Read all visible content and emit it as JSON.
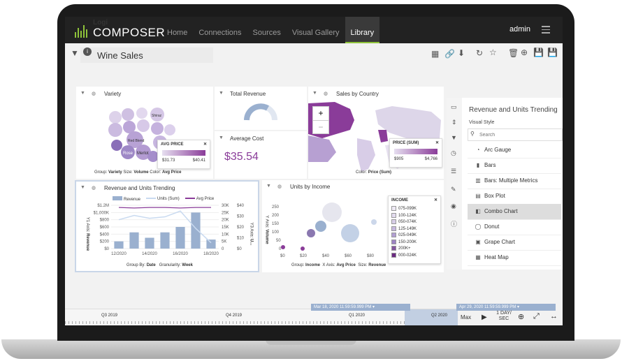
{
  "app": {
    "logo_small": "Logi",
    "logo_big": "COMPOSER",
    "nav": [
      "Home",
      "Connections",
      "Sources",
      "Visual Gallery",
      "Library"
    ],
    "active_nav": "Library",
    "user": "admin"
  },
  "dashboard": {
    "title": "Wine Sales"
  },
  "panels": {
    "variety": {
      "title": "Variety",
      "bubbles": [
        "Shiraz",
        "Red Blend",
        "Rose",
        "Merlot"
      ],
      "legend_title": "AVG PRICE",
      "legend_min": "$31.73",
      "legend_max": "$40.41",
      "footer_group_label": "Group:",
      "footer_group": "Variety",
      "footer_size_label": "Size:",
      "footer_size": "Volume",
      "footer_color_label": "Color:",
      "footer_color": "Avg Price"
    },
    "total_revenue": {
      "title": "Total Revenue"
    },
    "average_cost": {
      "title": "Average Cost",
      "value": "$35.54"
    },
    "sales_by_country": {
      "title": "Sales by Country",
      "legend_title": "PRICE (SUM)",
      "legend_min": "$905",
      "legend_max": "$4,766",
      "footer_color_label": "Color:",
      "footer_color": "Price (Sum)",
      "zoom_plus": "+",
      "zoom_minus": "−"
    },
    "revenue_trending": {
      "title": "Revenue and Units Trending",
      "legend": [
        "Revenue",
        "Units (Sum)",
        "Avg Price"
      ],
      "y1_label_prefix": "Y1 Axis:",
      "y1_label": "Revenue",
      "y2_label_prefix": "Y3 Axis:",
      "y2_label": "U...",
      "footer_group_label": "Group By:",
      "footer_group": "Date",
      "footer_gran_label": "Granularity:",
      "footer_gran": "Week"
    },
    "units_by_income": {
      "title": "Units by Income",
      "y_label_prefix": "Y Axis:",
      "y_label": "Volume",
      "footer_group_label": "Group:",
      "footer_group": "Income",
      "footer_x_label": "X Axis:",
      "footer_x": "Avg Price",
      "footer_size_label": "Size:",
      "footer_size": "Revenue",
      "legend_title": "INCOME",
      "legend_items": [
        "075-099K",
        "100-124K",
        "050-074K",
        "125-149K",
        "025-049K",
        "150-200K",
        "200K+",
        "000-024K"
      ]
    }
  },
  "visual_style": {
    "panel_title": "Revenue and Units Trending",
    "section": "Visual Style",
    "search_placeholder": "Search",
    "items": [
      "Arc Gauge",
      "Bars",
      "Bars: Multiple Metrics",
      "Box Plot",
      "Combo Chart",
      "Donut",
      "Grape Chart",
      "Heat Map"
    ],
    "selected": "Combo Chart"
  },
  "timeline": {
    "left_tag": "Mar 18, 2020 11:59:59.999 PM",
    "right_tag": "Apr 29, 2020 11:59:59.999 PM",
    "quarters": [
      "Q3 2019",
      "Q4 2019",
      "Q1 2020",
      "Q2 2020"
    ],
    "max_label": "Max",
    "step_label": "1 DAY/ SEC"
  },
  "colors": {
    "accent": "#8fc33a",
    "purple": "#8a3c99",
    "bar_blue": "#9ab0cf"
  },
  "chart_data": {
    "type": "bar",
    "title": "Revenue and Units Trending",
    "categories": [
      "12/2020",
      "",
      "14/2020",
      "",
      "16/2020",
      "",
      "18/2020"
    ],
    "x_tick_labels": [
      "12/2020",
      "14/2020",
      "16/2020",
      "18/2020"
    ],
    "series": [
      {
        "name": "Revenue",
        "values": [
          200,
          450,
          300,
          450,
          600,
          1000,
          250
        ]
      },
      {
        "name": "Units (Sum)",
        "values": [
          20,
          23,
          21,
          22,
          26,
          14,
          4
        ]
      },
      {
        "name": "Avg Price",
        "values": [
          38,
          37.5,
          38,
          38,
          37.5,
          38,
          38
        ]
      }
    ],
    "y1_ticks": [
      "$0",
      "$200",
      "$400",
      "$600",
      "$800",
      "$1,000K",
      "$1.2M"
    ],
    "y2_ticks": [
      "0",
      "5K",
      "10K",
      "15K",
      "20K",
      "25K",
      "30K"
    ],
    "y3_ticks": [
      "$0",
      "$10",
      "$20",
      "$30",
      "$40"
    ],
    "ylim": [
      0,
      1200
    ]
  }
}
